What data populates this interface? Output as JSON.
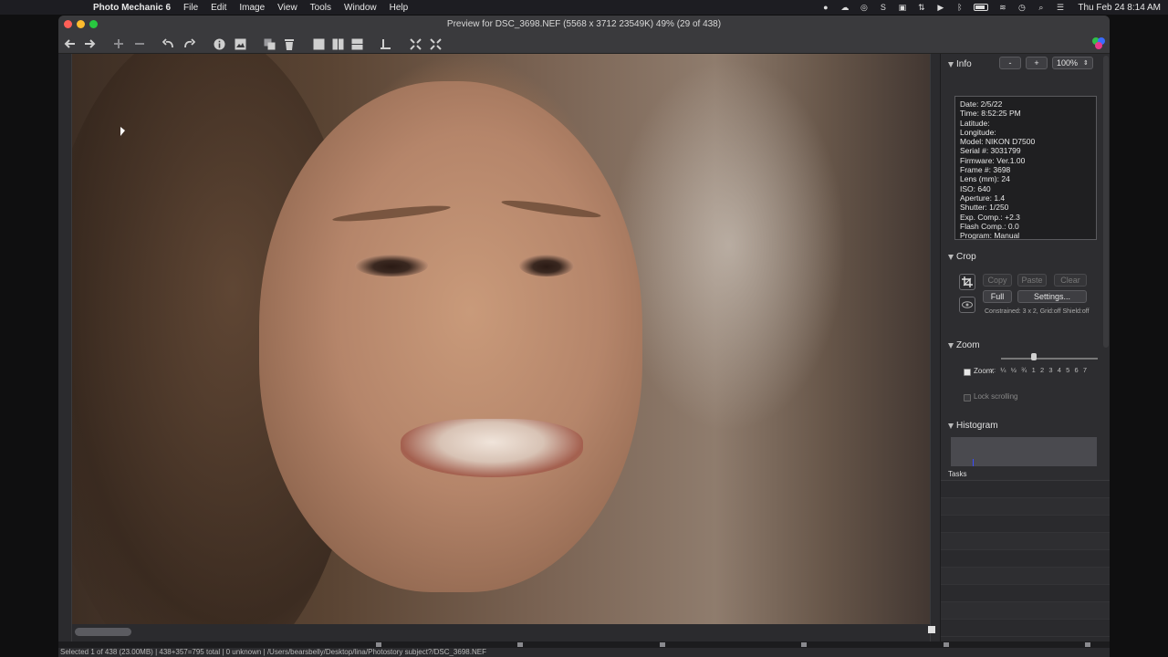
{
  "menubar": {
    "app_name": "Photo Mechanic 6",
    "menus": [
      "File",
      "Edit",
      "Image",
      "View",
      "Tools",
      "Window",
      "Help"
    ],
    "clock": "Thu Feb 24  8:14 AM"
  },
  "window": {
    "title": "Preview for DSC_3698.NEF (5568 x 3712 23549K) 49% (29 of 438)"
  },
  "info": {
    "header": "Info",
    "zoom_minus": "-",
    "zoom_plus": "+",
    "zoom_level": "100%",
    "lines": [
      "Date: 2/5/22",
      "Time: 8:52:25 PM",
      "Latitude:",
      "Longitude:",
      "Model: NIKON D7500",
      "Serial #: 3031799",
      "Firmware: Ver.1.00",
      "Frame #: 3698",
      "Lens (mm): 24",
      "ISO: 640",
      "Aperture: 1.4",
      "Shutter: 1/250",
      "Exp. Comp.: +2.3",
      "Flash Comp.: 0.0",
      "Program: Manual"
    ]
  },
  "crop": {
    "header": "Crop",
    "copy": "Copy",
    "paste": "Paste",
    "clear": "Clear",
    "full": "Full",
    "settings": "Settings...",
    "constraint_text": "Constrained: 3 x 2, Grid:off Shield:off"
  },
  "zoom": {
    "header": "Zoom",
    "zoom_label": "Zoom:",
    "ticks": [
      "x:",
      "¼",
      "½",
      "¾",
      "1",
      "2",
      "3",
      "4",
      "5",
      "6",
      "7"
    ],
    "lock_label": "Lock scrolling"
  },
  "histogram": {
    "header": "Histogram"
  },
  "tasks": {
    "header": "Tasks"
  },
  "status": {
    "text": "Selected 1 of 438 (23.00MB) | 438+357=795 total | 0 unknown | /Users/bearsbelly/Desktop/lina/Photostory subject?/DSC_3698.NEF"
  }
}
